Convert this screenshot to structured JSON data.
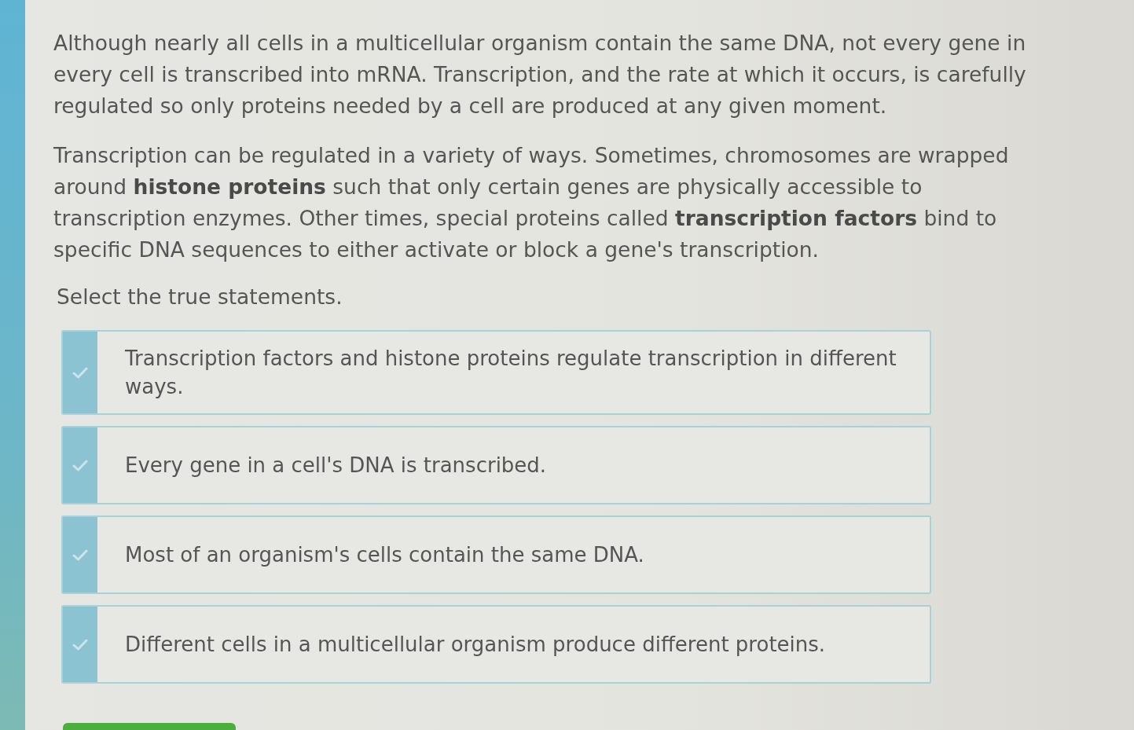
{
  "paragraphs": [
    "Although nearly all cells in a multicellular organism contain the same DNA, not every gene in every cell is transcribed into mRNA. Transcription, and the rate at which it occurs, is carefully regulated so only proteins needed by a cell are produced at any given moment.",
    "Transcription can be regulated in a variety of ways. Sometimes, chromosomes are wrapped around **histone proteins** such that only certain genes are physically accessible to transcription enzymes. Other times, special proteins called **transcription factors** bind to specific DNA sequences to either activate or block a gene's transcription."
  ],
  "prompt": "Select the true statements.",
  "options": [
    {
      "text": "Transcription factors and histone proteins regulate transcription in different ways.",
      "checked": false
    },
    {
      "text": "Every gene in a cell's DNA is transcribed.",
      "checked": false
    },
    {
      "text": "Most of an organism's cells contain the same DNA.",
      "checked": false
    },
    {
      "text": "Different cells in a multicellular organism produce different proteins.",
      "checked": false
    }
  ]
}
